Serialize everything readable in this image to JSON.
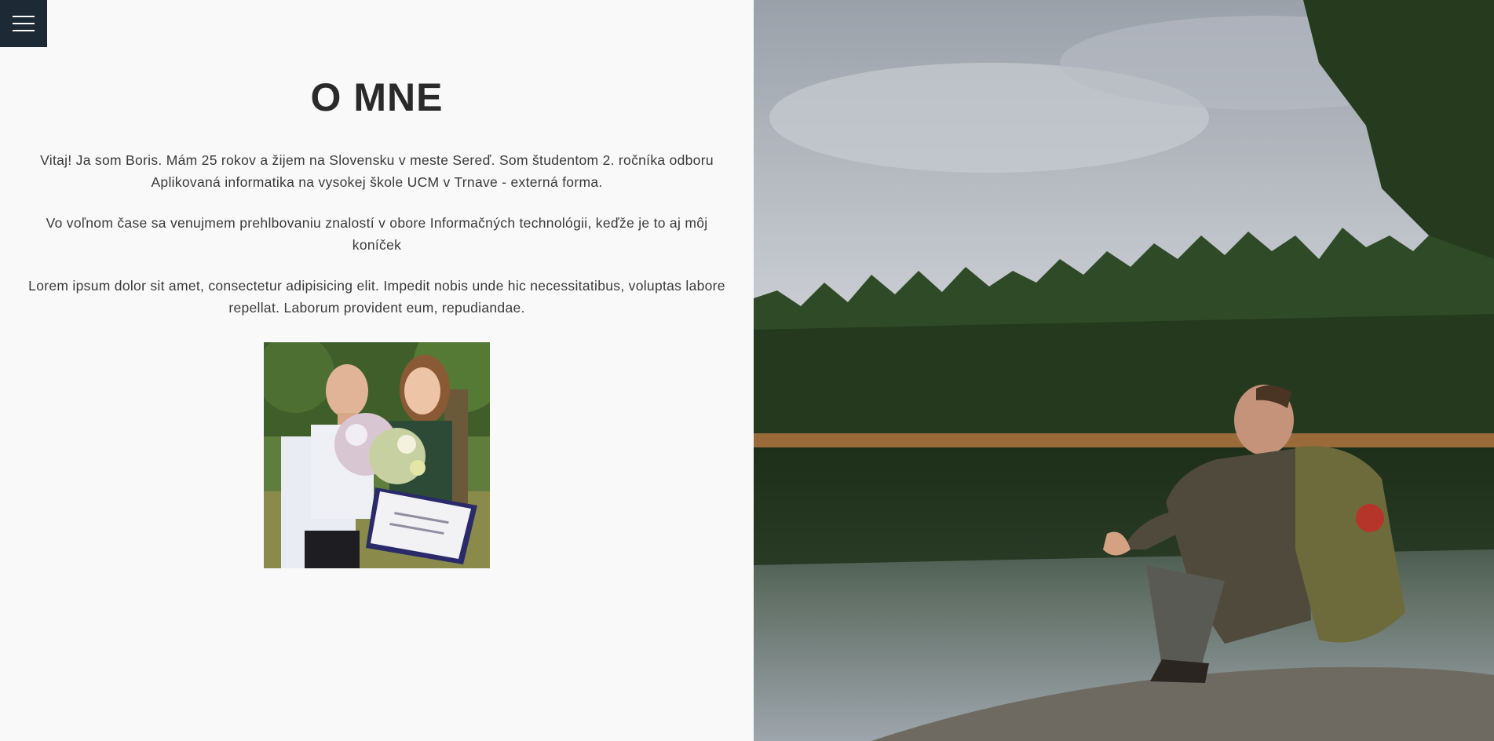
{
  "menu": {
    "icon": "hamburger-icon"
  },
  "about": {
    "title": "O MNE",
    "paragraphs": [
      "Vitaj! Ja som Boris. Mám 25 rokov a žijem na Slovensku v meste Sereď. Som študentom 2. ročníka odboru Aplikovaná informatika na vysokej škole UCM v Trnave - externá forma.",
      "Vo voľnom čase sa venujmem prehlbovaniu znalostí v obore Informačných technológii, keďže je to aj môj koníček",
      "Lorem ipsum dolor sit amet, consectetur adipisicing elit. Impedit nobis unde hic necessitatibus, voluptas labore repellat. Laborum provident eum, repudiandae."
    ]
  },
  "colors": {
    "menu_bg": "#1d2935",
    "page_bg": "#f9f9f9",
    "text": "#333333"
  }
}
